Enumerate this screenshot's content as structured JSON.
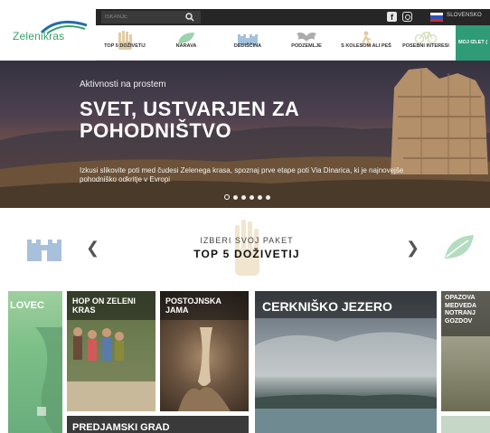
{
  "brand": {
    "logo_text": "Zelenikras"
  },
  "topbar": {
    "search_placeholder": "ISKANJE",
    "language": "SLOVENSKO"
  },
  "nav": {
    "items": [
      {
        "label": "TOP 5 DOŽIVETIJ"
      },
      {
        "label": "NARAVA"
      },
      {
        "label": "DEDIŠČINA"
      },
      {
        "label": "PODZEMLJE"
      },
      {
        "label": "S KOLESOM ALI PEŠ"
      },
      {
        "label": "POSEBNI INTERESI"
      },
      {
        "label": "MOJ IZLET ("
      }
    ]
  },
  "hero": {
    "kicker": "Aktivnosti na prostem",
    "title": "SVET, USTVARJEN ZA POHODNIŠTVO",
    "text": "Izkusi slikovite poti med čudesi Zelenega krasa, spoznaj prve etape poti Via Dinarica, ki je najnovejše pohodniško odkritje v Evropi",
    "slides": 6,
    "active_slide": 0
  },
  "packages": {
    "kicker": "IZBERI SVOJ PAKET",
    "title": "TOP 5 DOŽIVETIJ"
  },
  "tiles": [
    {
      "title": "LOVEC"
    },
    {
      "title": "HOP ON ZELENI KRAS"
    },
    {
      "title": "POSTOJNSKA JAMA"
    },
    {
      "title": "CERKNIŠKO JEZERO"
    },
    {
      "title": "OPAZOVA MEDVEDA NOTRANJ GOZDOV"
    },
    {
      "title": "PREDJAMSKI GRAD"
    }
  ],
  "colors": {
    "accent": "#2f9c77",
    "topbar": "#262626",
    "brand_green": "#3aa06a"
  }
}
